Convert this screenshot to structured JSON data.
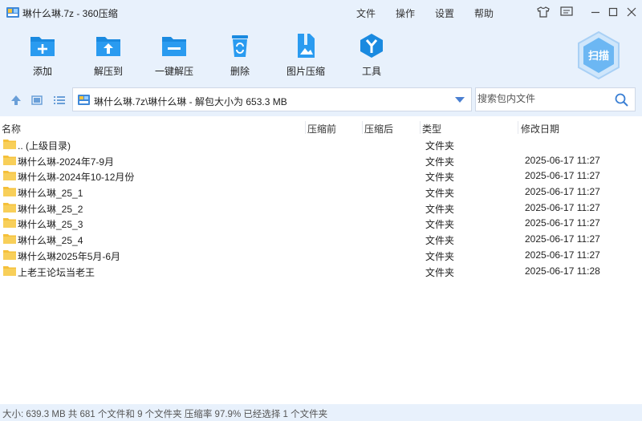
{
  "window": {
    "title": "琳什么琳.7z - 360压缩"
  },
  "menu": {
    "file": "文件",
    "operate": "操作",
    "settings": "设置",
    "help": "帮助"
  },
  "toolbar": {
    "add": "添加",
    "extract_to": "解压到",
    "one_click_extract": "一键解压",
    "delete": "删除",
    "image_compress": "图片压缩",
    "tools": "工具",
    "scan": "扫描"
  },
  "address": {
    "path": "琳什么琳.7z\\琳什么琳 - 解包大小为 653.3 MB",
    "search_placeholder": "搜索包内文件"
  },
  "columns": {
    "name": "名称",
    "compressed": "压缩前",
    "after": "压缩后",
    "type": "类型",
    "modified": "修改日期"
  },
  "files": [
    {
      "name": ".. (上级目录)",
      "type": "文件夹",
      "date": ""
    },
    {
      "name": "琳什么琳-2024年7-9月",
      "type": "文件夹",
      "date": "2025-06-17 11:27"
    },
    {
      "name": "琳什么琳-2024年10-12月份",
      "type": "文件夹",
      "date": "2025-06-17 11:27"
    },
    {
      "name": "琳什么琳_25_1",
      "type": "文件夹",
      "date": "2025-06-17 11:27"
    },
    {
      "name": "琳什么琳_25_2",
      "type": "文件夹",
      "date": "2025-06-17 11:27"
    },
    {
      "name": "琳什么琳_25_3",
      "type": "文件夹",
      "date": "2025-06-17 11:27"
    },
    {
      "name": "琳什么琳_25_4",
      "type": "文件夹",
      "date": "2025-06-17 11:27"
    },
    {
      "name": "琳什么琳2025年5月-6月",
      "type": "文件夹",
      "date": "2025-06-17 11:27"
    },
    {
      "name": "上老王论坛当老王",
      "type": "文件夹",
      "date": "2025-06-17 11:28"
    }
  ],
  "status": {
    "text": "大小: 639.3 MB 共 681 个文件和 9 个文件夹 压缩率 97.9% 已经选择 1 个文件夹"
  },
  "colors": {
    "accent": "#1a8ae0",
    "chrome_bg": "#e8f1fc",
    "folder": "#f5c03a"
  }
}
